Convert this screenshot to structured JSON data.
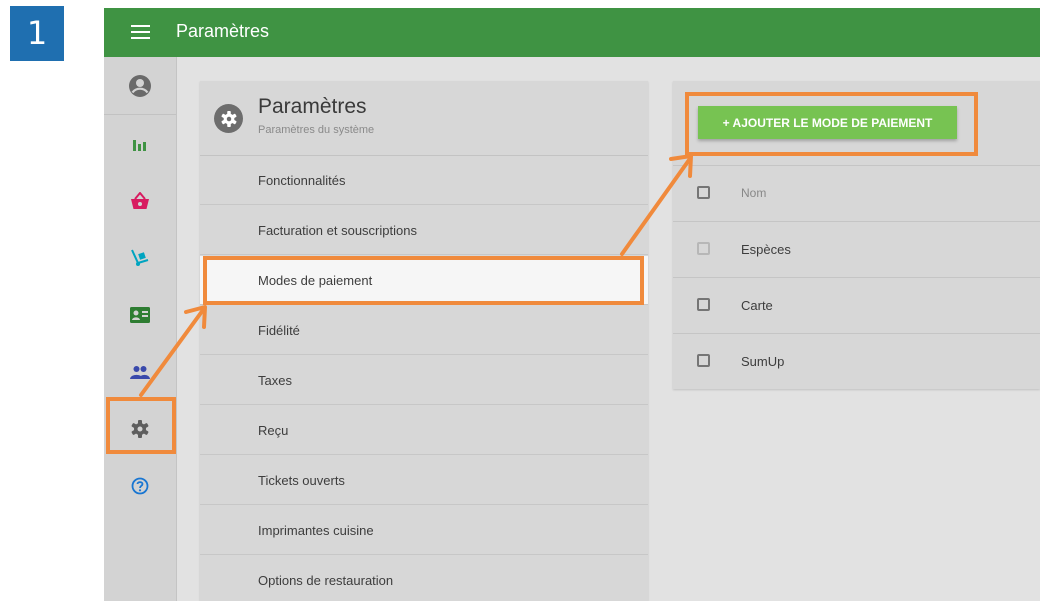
{
  "step": {
    "number": "1"
  },
  "topbar": {
    "title": "Paramètres",
    "menu_icon": "hamburger-menu-icon",
    "color": "#3f9343"
  },
  "sidebar": {
    "items": [
      {
        "name": "avatar",
        "icon": "account-circle-icon",
        "color": "#6a6a6a"
      },
      {
        "name": "reports",
        "icon": "bar-chart-icon",
        "color": "#3f9343"
      },
      {
        "name": "items",
        "icon": "basket-icon",
        "color": "#d81b60"
      },
      {
        "name": "inventory",
        "icon": "hand-truck-icon",
        "color": "#00a4c0"
      },
      {
        "name": "employees",
        "icon": "badge-icon",
        "color": "#2e7d32"
      },
      {
        "name": "customers",
        "icon": "people-icon",
        "color": "#3949ab"
      },
      {
        "name": "settings",
        "icon": "gear-icon",
        "color": "#5e5e5e"
      },
      {
        "name": "help",
        "icon": "help-icon",
        "color": "#1976d2"
      }
    ]
  },
  "settings_panel": {
    "title": "Paramètres",
    "subtitle": "Paramètres du système",
    "items": [
      {
        "label": "Fonctionnalités"
      },
      {
        "label": "Facturation et souscriptions"
      },
      {
        "label": "Modes de paiement",
        "selected": true
      },
      {
        "label": "Fidélité"
      },
      {
        "label": "Taxes"
      },
      {
        "label": "Reçu"
      },
      {
        "label": "Tickets ouverts"
      },
      {
        "label": "Imprimantes cuisine"
      },
      {
        "label": "Options de restauration"
      }
    ]
  },
  "payments_panel": {
    "add_button_label": "+ AJOUTER LE MODE DE PAIEMENT",
    "header": {
      "column": "Nom"
    },
    "rows": [
      {
        "name": "Espèces",
        "checkbox_disabled": true
      },
      {
        "name": "Carte"
      },
      {
        "name": "SumUp"
      }
    ]
  },
  "annotation": {
    "color": "#f08a3c"
  }
}
